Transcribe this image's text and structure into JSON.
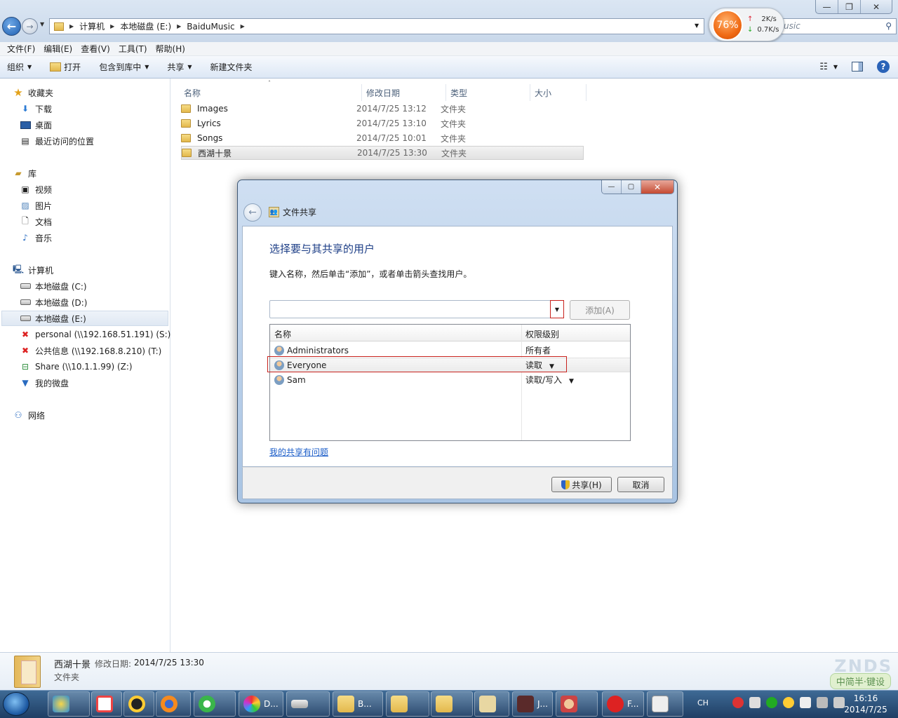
{
  "address_bar": {
    "crumbs": [
      "计算机",
      "本地磁盘 (E:)",
      "BaiduMusic"
    ],
    "search_partial": "usic"
  },
  "speed_widget": {
    "percent": "76%",
    "upload": "2K/s",
    "download": "0.7K/s"
  },
  "menubar": [
    "文件(F)",
    "编辑(E)",
    "查看(V)",
    "工具(T)",
    "帮助(H)"
  ],
  "toolbar": {
    "organize": "组织",
    "open": "打开",
    "include_library": "包含到库中",
    "share": "共享",
    "new_folder": "新建文件夹"
  },
  "sidebar": {
    "favorites": "收藏夹",
    "fav_items": [
      "下载",
      "桌面",
      "最近访问的位置"
    ],
    "libraries": "库",
    "lib_items": [
      "视频",
      "图片",
      "文档",
      "音乐"
    ],
    "computer": "计算机",
    "drives": [
      "本地磁盘 (C:)",
      "本地磁盘 (D:)",
      "本地磁盘 (E:)",
      "personal (\\\\192.168.51.191) (S:)",
      "公共信息 (\\\\192.168.8.210) (T:)",
      "Share (\\\\10.1.1.99) (Z:)",
      "我的微盘"
    ],
    "network": "网络"
  },
  "columns": [
    "名称",
    "修改日期",
    "类型",
    "大小"
  ],
  "files": [
    {
      "name": "Images",
      "date": "2014/7/25 13:12",
      "type": "文件夹"
    },
    {
      "name": "Lyrics",
      "date": "2014/7/25 13:10",
      "type": "文件夹"
    },
    {
      "name": "Songs",
      "date": "2014/7/25 10:01",
      "type": "文件夹"
    },
    {
      "name": "西湖十景",
      "date": "2014/7/25 13:30",
      "type": "文件夹"
    }
  ],
  "details": {
    "name": "西湖十景",
    "modified_label": "修改日期:",
    "modified": "2014/7/25 13:30",
    "type": "文件夹"
  },
  "dialog": {
    "title": "文件共享",
    "heading": "选择要与其共享的用户",
    "instruction": "键入名称，然后单击“添加”，或者单击箭头查找用户。",
    "add_button": "添加(A)",
    "col_name": "名称",
    "col_perm": "权限级别",
    "users": [
      {
        "name": "Administrators",
        "perm": "所有者"
      },
      {
        "name": "Everyone",
        "perm": "读取"
      },
      {
        "name": "Sam",
        "perm": "读取/写入"
      }
    ],
    "help_link": "我的共享有问题",
    "share_button": "共享(H)",
    "cancel_button": "取消"
  },
  "taskbar": {
    "items": [
      "D...",
      "B...",
      "J...",
      "F..."
    ],
    "ime": "CH",
    "time": "16:16",
    "date": "2014/7/25"
  },
  "watermark": {
    "top": "ZNDS",
    "bottom": "中简半·键设"
  },
  "colors": {
    "accent": "#1e3f87",
    "highlight_box": "#c8221d",
    "link": "#1a5cc8",
    "taskbar": "#1f3e64"
  }
}
